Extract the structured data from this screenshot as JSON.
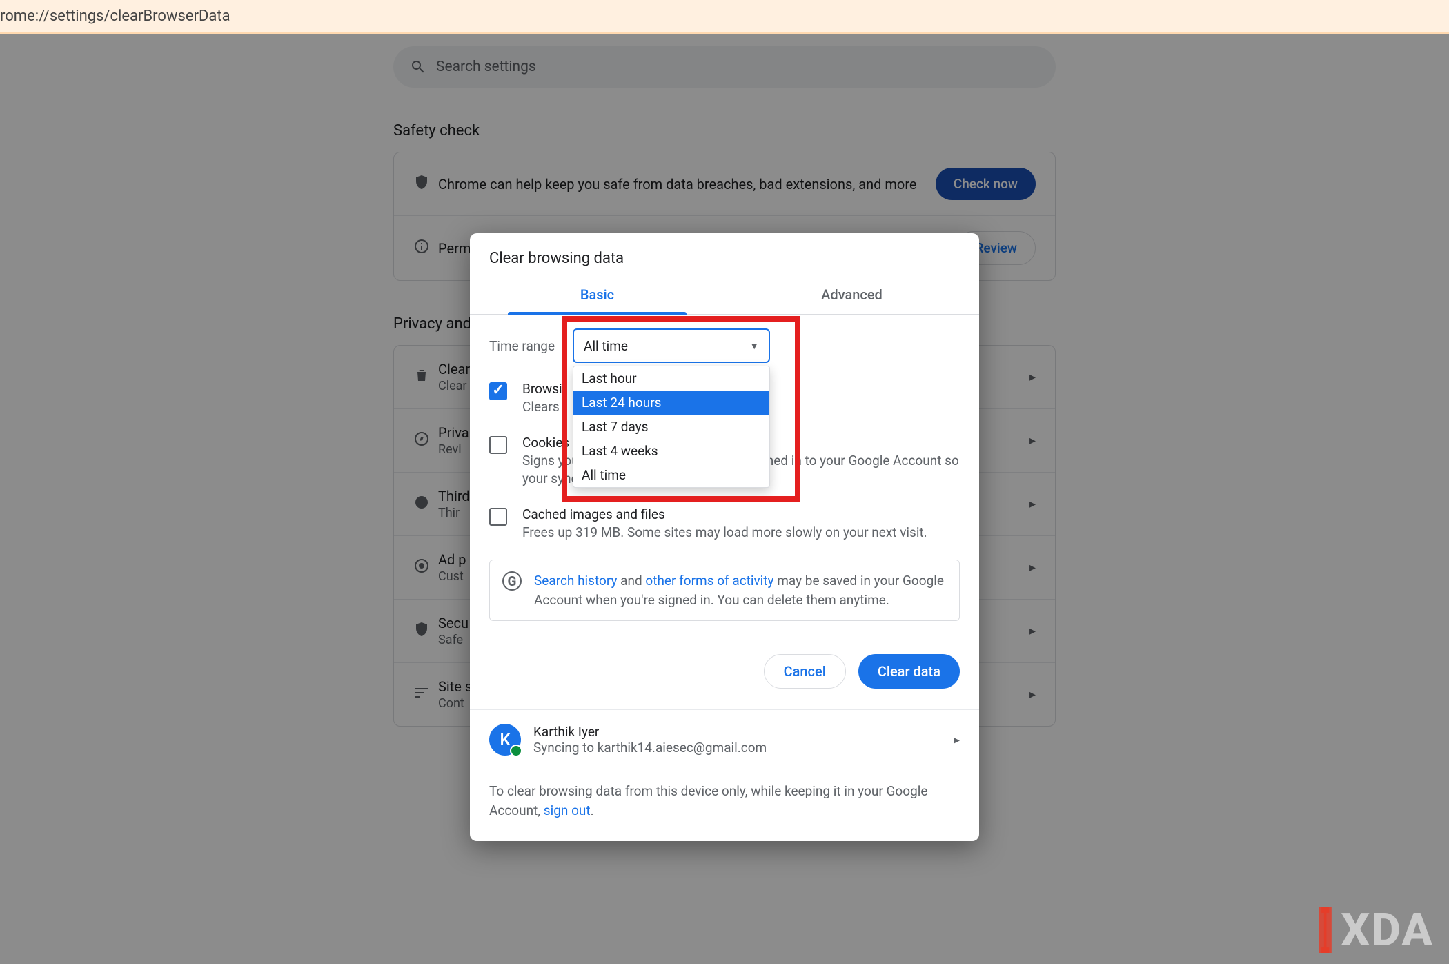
{
  "address_bar": "rome://settings/clearBrowserData",
  "search_placeholder": "Search settings",
  "sections": {
    "safety_check_heading": "Safety check",
    "safety_row": {
      "text": "Chrome can help keep you safe from data breaches, bad extensions, and more",
      "button": "Check now"
    },
    "perm_row": {
      "title": "Perm",
      "button": "Review"
    },
    "privacy_heading": "Privacy and s",
    "rows": [
      {
        "title": "Clear",
        "subtitle": "Clear"
      },
      {
        "title": "Priva",
        "subtitle": "Revi"
      },
      {
        "title": "Third",
        "subtitle": "Thir"
      },
      {
        "title": "Ad p",
        "subtitle": "Cust"
      },
      {
        "title": "Secu",
        "subtitle": "Safe"
      },
      {
        "title": "Site s",
        "subtitle": "Cont"
      }
    ]
  },
  "modal": {
    "title": "Clear browsing data",
    "tabs": {
      "basic": "Basic",
      "advanced": "Advanced"
    },
    "time_range_label": "Time range",
    "time_range_selected": "All time",
    "time_range_options": [
      "Last hour",
      "Last 24 hours",
      "Last 7 days",
      "Last 4 weeks",
      "All time"
    ],
    "time_range_hover_index": 1,
    "items": [
      {
        "title": "Browsi",
        "subtitle": "Clears",
        "checked": true
      },
      {
        "title": "Cookies and other site data",
        "subtitle": "Signs you out of most sites. You'll stay signed in to your Google Account so your synced data can be cleared.",
        "checked": false
      },
      {
        "title": "Cached images and files",
        "subtitle": "Frees up 319 MB. Some sites may load more slowly on your next visit.",
        "checked": false
      }
    ],
    "info_prefix": "",
    "info_link1": "Search history",
    "info_mid1": " and ",
    "info_link2": "other forms of activity",
    "info_tail": " may be saved in your Google Account when you're signed in. You can delete them anytime.",
    "cancel": "Cancel",
    "clear": "Clear data",
    "user": {
      "initial": "K",
      "name": "Karthik Iyer",
      "sync": "Syncing to karthik14.aiesec@gmail.com"
    },
    "footnote_pre": "To clear browsing data from this device only, while keeping it in your Google Account, ",
    "footnote_link": "sign out",
    "footnote_post": "."
  },
  "watermark": "XDA"
}
